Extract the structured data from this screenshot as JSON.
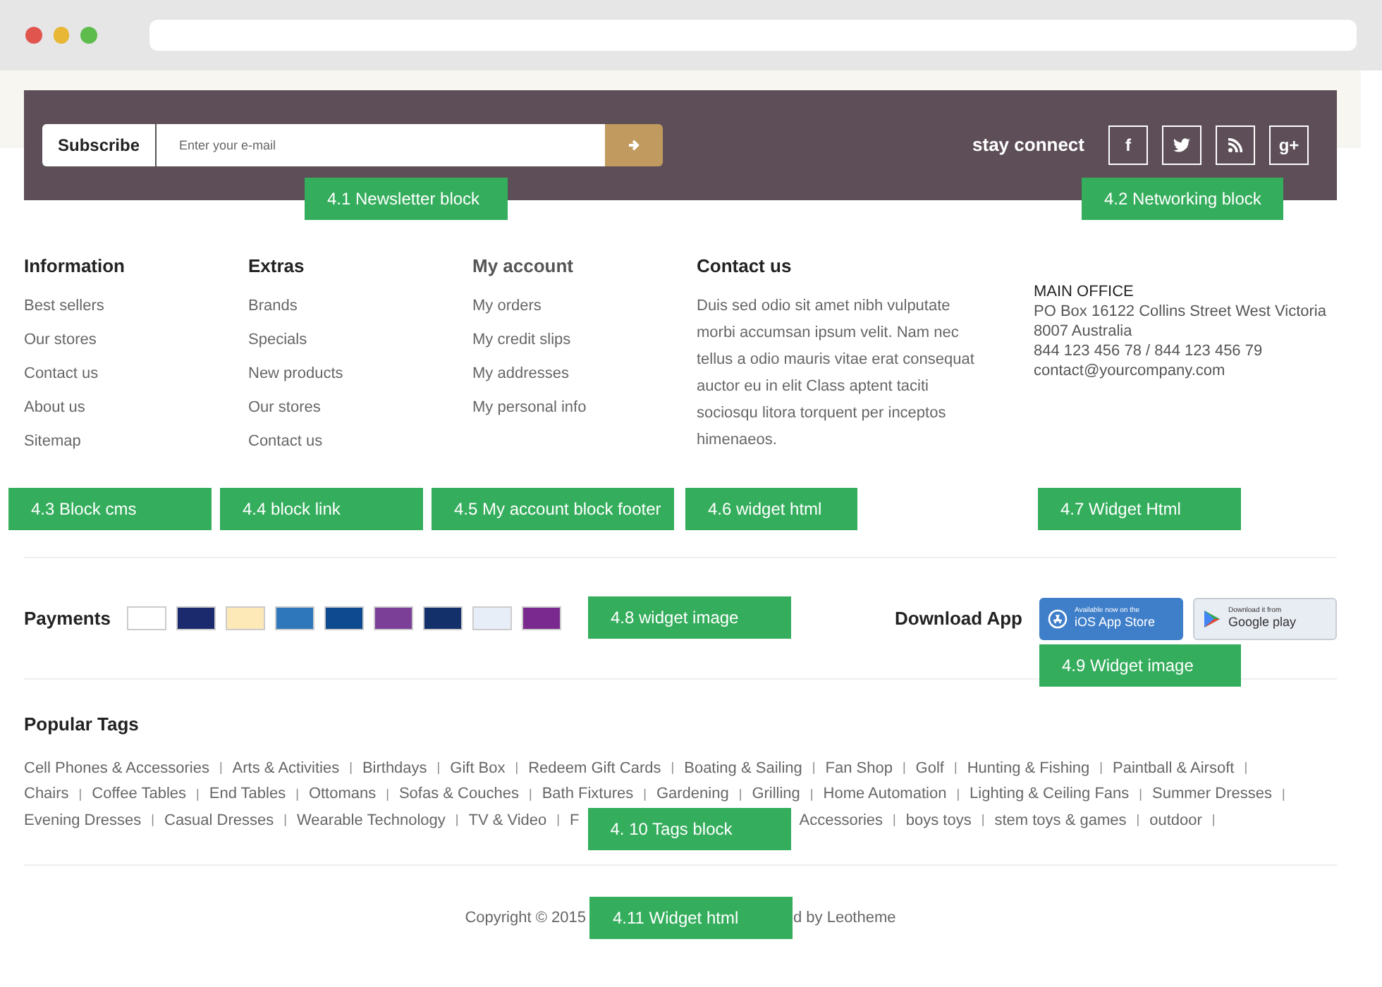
{
  "newsletter": {
    "label": "Subscribe",
    "placeholder": "Enter your e-mail"
  },
  "social": {
    "title": "stay connect",
    "icons": [
      {
        "kind": "glyph",
        "text": "f"
      },
      {
        "kind": "bird"
      },
      {
        "kind": "rss"
      },
      {
        "kind": "glyph",
        "text": "g+"
      }
    ]
  },
  "callouts": [
    "4.1 Newsletter block",
    "4.2 Networking block",
    "4.3 Block cms",
    "4.4 block link",
    "4.5 My account block footer",
    "4.6 widget html",
    "4.7 Widget Html",
    "4.8 widget image",
    "4.9 Widget image"
  ],
  "columns": [
    {
      "title": "Information",
      "links": [
        "Best sellers",
        "Our stores",
        "Contact us",
        "About us",
        "Sitemap"
      ]
    },
    {
      "title": "Extras",
      "links": [
        "Brands",
        "Specials",
        "New products",
        "Our stores",
        "Contact us"
      ]
    },
    {
      "title": "My account",
      "links": [
        "My orders",
        "My credit slips",
        "My addresses",
        "My personal info"
      ]
    }
  ],
  "contact": {
    "title": "Contact us",
    "text": "Duis sed odio sit amet nibh vulputate morbi accumsan ipsum velit. Nam nec tellus a odio mauris vitae erat consequat auctor eu in elit Class aptent taciti sociosqu litora torquent per inceptos himenaeos."
  },
  "office": [
    "MAIN OFFICE",
    "PO Box 16122 Collins Street West Victoria",
    "8007 Australia",
    "844 123 456 78 / 844 123 456 79",
    "contact@yourcompany.com"
  ],
  "payments": {
    "title": "Payments",
    "cards": [
      {
        "color": "#ffffff"
      },
      {
        "color": "#1a2a6c"
      },
      {
        "color": "#fde8b8"
      },
      {
        "color": "#2e77bb"
      },
      {
        "color": "#0d4a8f"
      },
      {
        "color": "#7b3f98"
      },
      {
        "color": "#14306b"
      },
      {
        "color": "#e8eef8"
      },
      {
        "color": "#7a2a8f"
      }
    ]
  },
  "apps": {
    "title": "Download App",
    "buttons": [
      {
        "kind": "ios",
        "small": "Available now on the",
        "big": "iOS App Store"
      },
      {
        "kind": "google",
        "small": "Download it from",
        "big": "Google play"
      }
    ]
  },
  "tags": {
    "title": "Popular Tags",
    "separator": "|",
    "items": [
      {
        "kind": "tag",
        "text": "Cell Phones & Accessories"
      },
      {
        "kind": "tag",
        "text": "Arts & Activities"
      },
      {
        "kind": "tag",
        "text": "Birthdays"
      },
      {
        "kind": "tag",
        "text": "Gift Box"
      },
      {
        "kind": "tag",
        "text": "Redeem Gift Cards"
      },
      {
        "kind": "tag",
        "text": "Boating & Sailing"
      },
      {
        "kind": "tag",
        "text": "Fan Shop"
      },
      {
        "kind": "tag",
        "text": "Golf"
      },
      {
        "kind": "tag",
        "text": "Hunting & Fishing"
      },
      {
        "kind": "tag",
        "text": "Paintball & Airsoft"
      },
      {
        "kind": "tag",
        "text": "Chairs"
      },
      {
        "kind": "tag",
        "text": "Coffee Tables"
      },
      {
        "kind": "tag",
        "text": "End Tables"
      },
      {
        "kind": "tag",
        "text": "Ottomans"
      },
      {
        "kind": "tag",
        "text": "Sofas & Couches"
      },
      {
        "kind": "tag",
        "text": "Bath Fixtures"
      },
      {
        "kind": "tag",
        "text": "Gardening"
      },
      {
        "kind": "tag",
        "text": "Grilling"
      },
      {
        "kind": "tag",
        "text": "Home Automation"
      },
      {
        "kind": "tag",
        "text": "Lighting & Ceiling Fans"
      },
      {
        "kind": "tag",
        "text": "Summer Dresses"
      },
      {
        "kind": "tag",
        "text": "Evening Dresses"
      },
      {
        "kind": "tag",
        "text": "Casual Dresses"
      },
      {
        "kind": "tag",
        "text": "Wearable Technology"
      },
      {
        "kind": "tag",
        "text": "TV & Video"
      },
      {
        "kind": "tag",
        "text": "F"
      },
      {
        "kind": "callout",
        "text": "4. 10 Tags block"
      },
      {
        "kind": "tag",
        "text": "Accessories"
      },
      {
        "kind": "tag",
        "text": "boys toys"
      },
      {
        "kind": "tag",
        "text": "stem toys & games"
      },
      {
        "kind": "tag",
        "text": "outdoor"
      }
    ]
  },
  "copyright": {
    "before": "Copyright © 2015",
    "callout": "4.11 Widget html",
    "after": "d by Leotheme"
  }
}
